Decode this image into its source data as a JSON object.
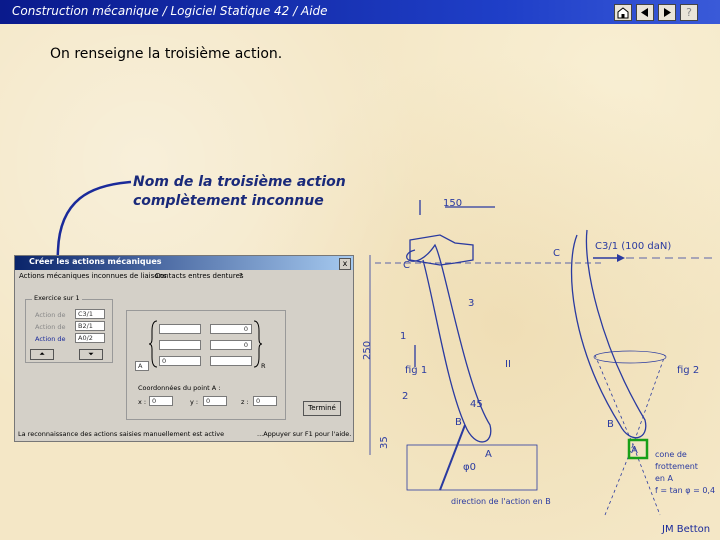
{
  "titlebar": {
    "title": "Construction mécanique / Logiciel Statique 42 / Aide",
    "buttons": [
      "home-icon",
      "back-icon",
      "forward-icon",
      "help-icon"
    ]
  },
  "heading": "On renseigne la troisième action.",
  "annotation": {
    "line1": "Nom de la troisième action",
    "line2": "complètement inconnue"
  },
  "dialog": {
    "title": "Créer les actions mécaniques",
    "close": "x",
    "menu": [
      "Actions mécaniques inconnues de liaisons",
      "Contacts entres dentures",
      "?"
    ],
    "group_label": "Exercice sur 1",
    "actions": [
      {
        "label": "Action de",
        "value": "C3/1"
      },
      {
        "label": "Action de",
        "value": "B2/1"
      },
      {
        "label": "Action de",
        "value": "A0/2"
      }
    ],
    "nav_up": "⏶",
    "nav_down": "⏷",
    "point_label": "A",
    "torsor_right_label": "R",
    "torsor_values": [
      "",
      "0",
      "",
      "0",
      "0",
      ""
    ],
    "coords_title": "Coordonnées du point A :",
    "coords": [
      {
        "axis": "x :",
        "value": "0"
      },
      {
        "axis": "y :",
        "value": "0"
      },
      {
        "axis": "z :",
        "value": "0"
      }
    ],
    "done_button": "Terminé",
    "status_left": "La reconnaissance des actions saisies manuellement est active",
    "status_right": "...Appuyer sur F1 pour l'aide."
  },
  "drawing": {
    "dim_150": "150",
    "label_C": "C",
    "label_C2": "C",
    "force_label": "C3/1 (100 daN)",
    "label_3": "3",
    "label_1": "1",
    "dim_250": "250",
    "fig1": "fig 1",
    "label_II": "II",
    "fig2": "fig 2",
    "label_2": "2",
    "dim_45": "45",
    "label_B": "B",
    "label_B2": "B",
    "label_A": "A",
    "label_A2": "A",
    "dim_35": "35",
    "phi0": "φ0",
    "cone_text": [
      "cone de",
      "frottement",
      "en A"
    ],
    "friction": "f = tan φ = 0,4",
    "direction": "direction de l'action en B"
  },
  "credit": "JM Betton",
  "colors": {
    "title_bar": "#0a1a8c",
    "annotation": "#1a2a7a",
    "drawing_blue": "#2a3aa0",
    "highlight": "#18a018"
  }
}
